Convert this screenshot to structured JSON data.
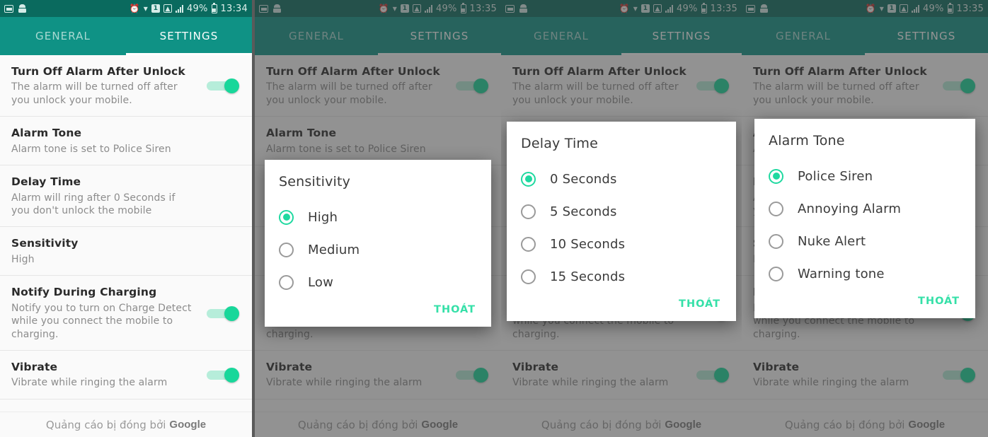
{
  "statusbar": {
    "left_icons": [
      "screenshot-icon",
      "vibrate-icon"
    ],
    "right_icons": [
      "alarm-icon",
      "wifi-icon",
      "sim-icon",
      "signal-icon",
      "signal2-icon"
    ],
    "battery_percent": "49%",
    "times": [
      "13:34",
      "13:35",
      "13:35",
      "13:35"
    ]
  },
  "tabs": {
    "general": "GENERAL",
    "settings": "SETTINGS",
    "active": "SETTINGS"
  },
  "settings_rows": [
    {
      "title": "Turn Off Alarm After Unlock",
      "subtitle": "The alarm will be turned off after you unlock your mobile.",
      "toggle": true
    },
    {
      "title": "Alarm Tone",
      "subtitle": "Alarm tone is set to Police Siren",
      "toggle": false
    },
    {
      "title": "Delay Time",
      "subtitle": "Alarm will ring after 0 Seconds if you don't unlock the mobile",
      "toggle": false
    },
    {
      "title": "Sensitivity",
      "subtitle": "High",
      "toggle": false
    },
    {
      "title": "Notify During Charging",
      "subtitle": "Notify you to turn on Charge Detect while you connect the mobile to charging.",
      "toggle": true
    },
    {
      "title": "Vibrate",
      "subtitle": "Vibrate while ringing the alarm",
      "toggle": true
    }
  ],
  "ad": {
    "text": "Quảng cáo bị đóng bởi",
    "brand": "Google"
  },
  "dialogs": {
    "sensitivity": {
      "title": "Sensitivity",
      "dismiss_label": "THOÁT",
      "options": [
        {
          "label": "High",
          "selected": true
        },
        {
          "label": "Medium",
          "selected": false
        },
        {
          "label": "Low",
          "selected": false
        }
      ]
    },
    "delay_time": {
      "title": "Delay Time",
      "dismiss_label": "THOÁT",
      "options": [
        {
          "label": "0 Seconds",
          "selected": true
        },
        {
          "label": "5 Seconds",
          "selected": false
        },
        {
          "label": "10 Seconds",
          "selected": false
        },
        {
          "label": "15 Seconds",
          "selected": false
        }
      ]
    },
    "alarm_tone": {
      "title": "Alarm Tone",
      "dismiss_label": "THOÁT",
      "options": [
        {
          "label": "Police Siren",
          "selected": true
        },
        {
          "label": "Annoying Alarm",
          "selected": false
        },
        {
          "label": "Nuke Alert",
          "selected": false
        },
        {
          "label": "Warning tone",
          "selected": false
        }
      ]
    }
  },
  "colors": {
    "accent_teal": "#0f9285",
    "statusbar_teal": "#0a6a5e",
    "toggle_green": "#18d79a",
    "radio_green": "#1fd9a0",
    "dialog_button_green": "#35e0a8"
  }
}
